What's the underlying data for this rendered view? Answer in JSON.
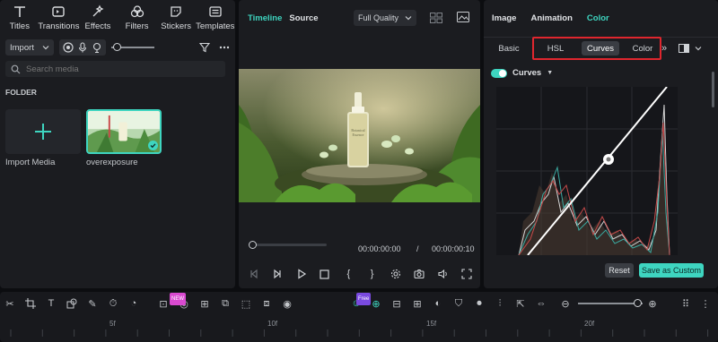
{
  "left": {
    "tabs": [
      {
        "label": "Titles",
        "icon": "titles-icon"
      },
      {
        "label": "Transitions",
        "icon": "transitions-icon"
      },
      {
        "label": "Effects",
        "icon": "effects-icon"
      },
      {
        "label": "Filters",
        "icon": "filters-icon"
      },
      {
        "label": "Stickers",
        "icon": "stickers-icon"
      },
      {
        "label": "Templates",
        "icon": "templates-icon"
      }
    ],
    "import_label": "Import",
    "search_placeholder": "Search media",
    "folder_label": "FOLDER",
    "media": [
      {
        "label": "Import Media"
      },
      {
        "label": "overexposure"
      }
    ]
  },
  "center": {
    "tab_timeline": "Timeline",
    "tab_source": "Source",
    "quality": "Full Quality",
    "time_current": "00:00:00:00",
    "time_separator": "/",
    "time_total": "00:00:00:10"
  },
  "right": {
    "tabs": [
      "Image",
      "Animation",
      "Color"
    ],
    "subtabs": [
      "Basic",
      "HSL",
      "Curves",
      "Color"
    ],
    "selected_subtab": "Curves",
    "curves_label": "Curves",
    "reset_label": "Reset",
    "save_label": "Save as Custom",
    "accent": "#3ed5c0",
    "highlight_box_color": "#e0262e"
  },
  "timeline": {
    "ruler_marks": [
      "5f",
      "10f",
      "15f",
      "20f"
    ],
    "badge_new": "NEW",
    "badge_free": "Free"
  }
}
